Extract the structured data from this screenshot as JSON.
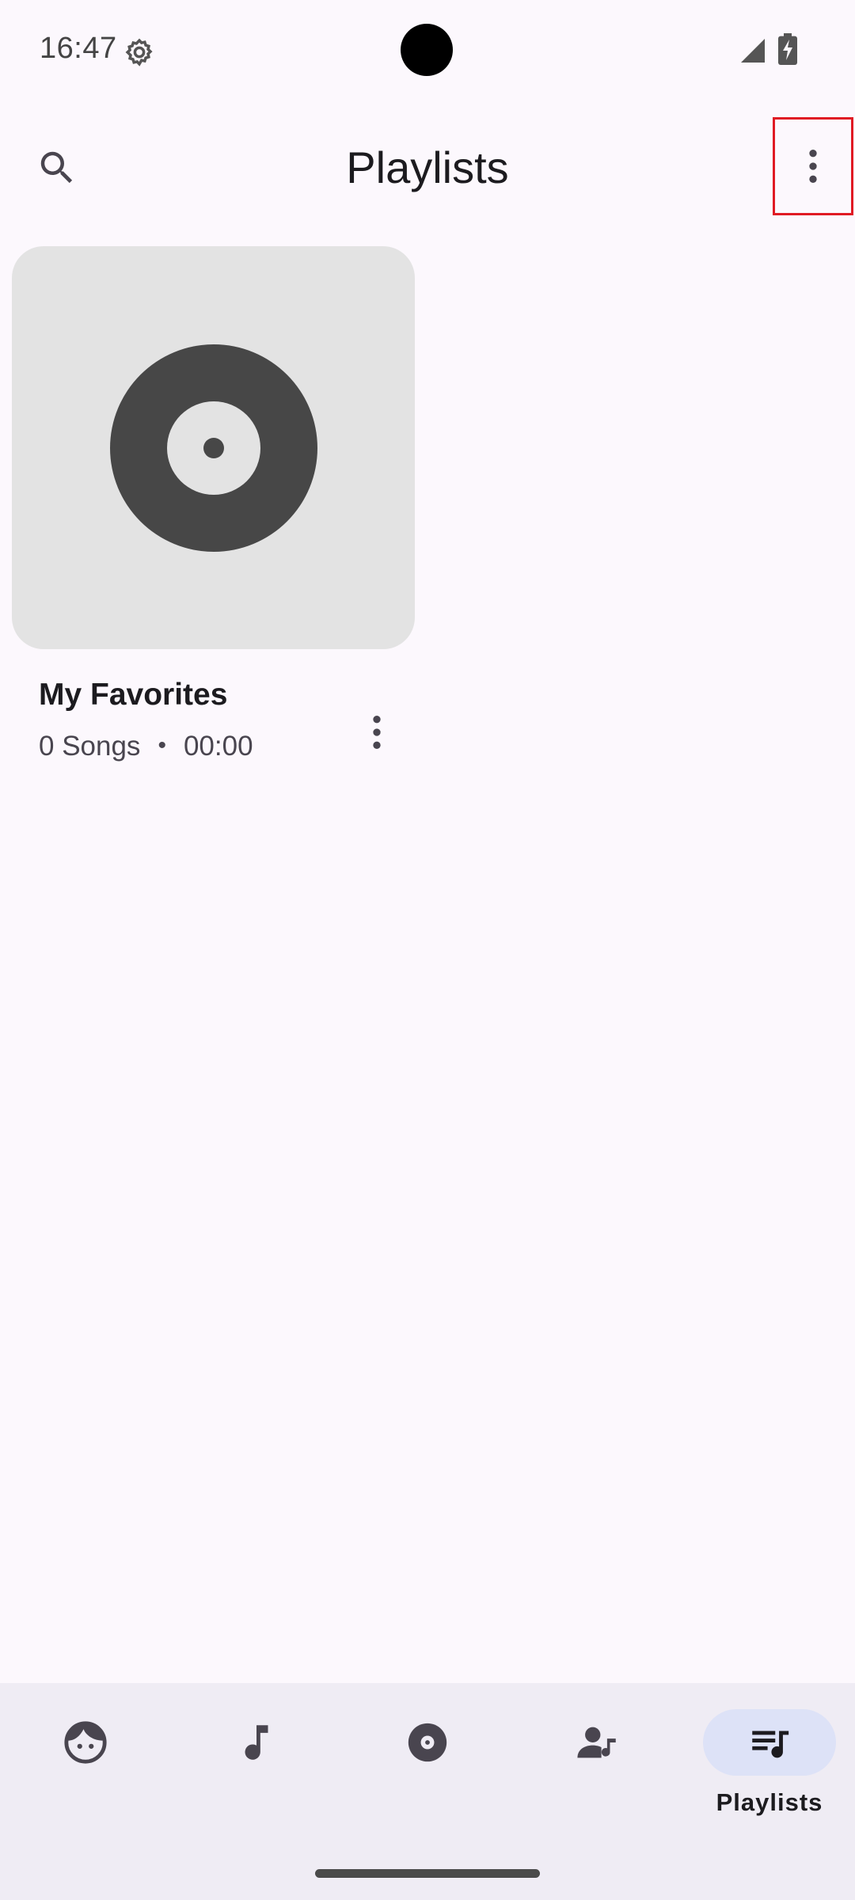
{
  "status_bar": {
    "time": "16:47",
    "icons": [
      "settings-icon",
      "signal-icon",
      "battery-charging-icon"
    ]
  },
  "app_bar": {
    "title": "Playlists",
    "search_icon": "search-icon",
    "overflow_icon": "more-vert-icon"
  },
  "playlists": [
    {
      "name": "My Favorites",
      "song_count": "0 Songs",
      "separator": "•",
      "duration": "00:00",
      "cover_icon": "vinyl-record-icon",
      "menu_icon": "more-vert-icon"
    }
  ],
  "bottom_nav": {
    "items": [
      {
        "id": "for-you",
        "icon": "face-icon",
        "label": ""
      },
      {
        "id": "songs",
        "icon": "music-note-icon",
        "label": ""
      },
      {
        "id": "albums",
        "icon": "album-icon",
        "label": ""
      },
      {
        "id": "artists",
        "icon": "artist-icon",
        "label": ""
      },
      {
        "id": "playlists",
        "icon": "queue-music-icon",
        "label": "Playlists",
        "active": true
      }
    ]
  },
  "colors": {
    "background": "#fcf8fd",
    "nav_background": "#efecf4",
    "active_pill": "#dde2f7",
    "icon": "#49454f",
    "highlight_box": "#e01b24"
  }
}
